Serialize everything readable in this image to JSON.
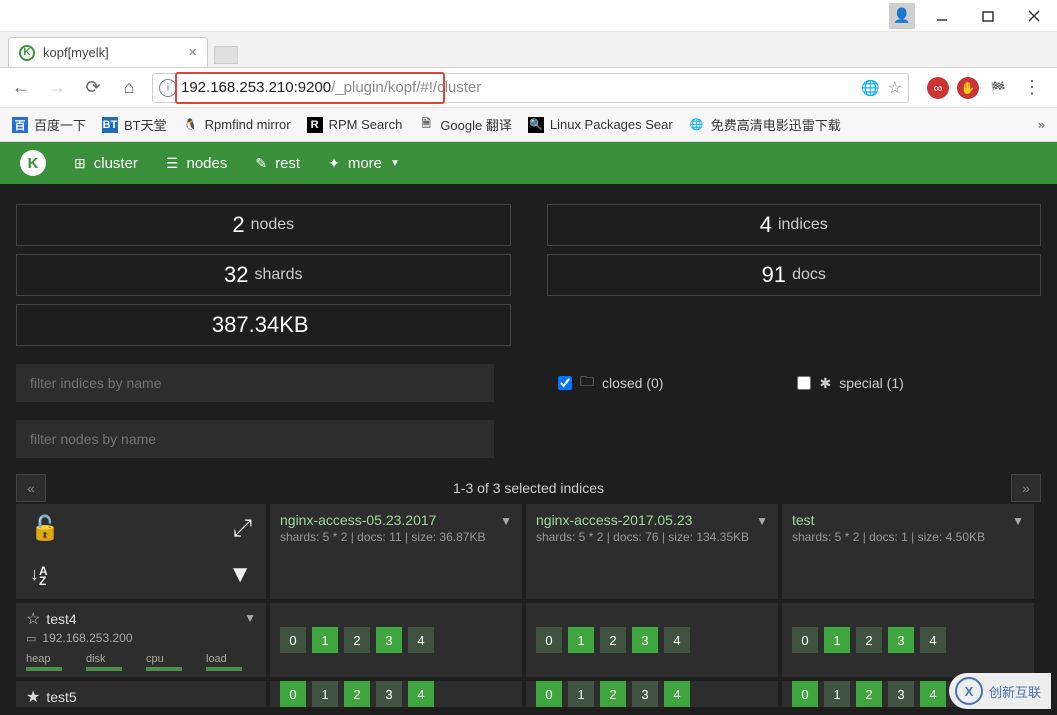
{
  "window": {
    "tab_title": "kopf[myelk]"
  },
  "url": {
    "host_port": "192.168.253.210:9200",
    "path": "/_plugin/kopf/",
    "hash": "#!/cluster"
  },
  "bookmarks": [
    {
      "icon": "百",
      "icon_bg": "#2b6cd4",
      "icon_color": "#fff",
      "label": "百度一下"
    },
    {
      "icon": "BT",
      "icon_bg": "#1d6fb8",
      "icon_color": "#fff",
      "label": "BT天堂"
    },
    {
      "icon": "🐧",
      "icon_bg": "transparent",
      "icon_color": "#000",
      "label": "Rpmfind mirror"
    },
    {
      "icon": "R",
      "icon_bg": "#000",
      "icon_color": "#fff",
      "label": "RPM Search"
    },
    {
      "icon": "🗎",
      "icon_bg": "transparent",
      "icon_color": "#666",
      "label": "Google 翻译"
    },
    {
      "icon": "🔍",
      "icon_bg": "#000",
      "icon_color": "#fff",
      "label": "Linux Packages Sear"
    },
    {
      "icon": "🌐",
      "icon_bg": "transparent",
      "icon_color": "#2b8",
      "label": "免费高清电影迅雷下载"
    }
  ],
  "nav": {
    "cluster": "cluster",
    "nodes": "nodes",
    "rest": "rest",
    "more": "more"
  },
  "stats": {
    "nodes_num": "2",
    "nodes_label": "nodes",
    "shards_num": "32",
    "shards_label": "shards",
    "size_value": "387.34KB",
    "indices_num": "4",
    "indices_label": "indices",
    "docs_num": "91",
    "docs_label": "docs"
  },
  "filters": {
    "indices_placeholder": "filter indices by name",
    "nodes_placeholder": "filter nodes by name",
    "closed_label": "closed (0)",
    "special_label": "special (1)"
  },
  "pager": {
    "text": "1-3 of 3 selected indices"
  },
  "indices": [
    {
      "name": "nginx-access-05.23.2017",
      "meta": "shards: 5 * 2 | docs: 11 | size: 36.87KB"
    },
    {
      "name": "nginx-access-2017.05.23",
      "meta": "shards: 5 * 2 | docs: 76 | size: 134.35KB"
    },
    {
      "name": "test",
      "meta": "shards: 5 * 2 | docs: 1 | size: 4.50KB"
    }
  ],
  "node": {
    "name": "test4",
    "ip": "192.168.253.200",
    "meters": [
      "heap",
      "disk",
      "cpu",
      "load"
    ]
  },
  "node2": {
    "name": "test5"
  },
  "shards": {
    "row1": [
      [
        {
          "n": "0",
          "s": "dim"
        },
        {
          "n": "1",
          "s": "bright"
        },
        {
          "n": "2",
          "s": "dim"
        },
        {
          "n": "3",
          "s": "bright"
        },
        {
          "n": "4",
          "s": "dim"
        }
      ],
      [
        {
          "n": "0",
          "s": "dim"
        },
        {
          "n": "1",
          "s": "bright"
        },
        {
          "n": "2",
          "s": "dim"
        },
        {
          "n": "3",
          "s": "bright"
        },
        {
          "n": "4",
          "s": "dim"
        }
      ],
      [
        {
          "n": "0",
          "s": "dim"
        },
        {
          "n": "1",
          "s": "bright"
        },
        {
          "n": "2",
          "s": "dim"
        },
        {
          "n": "3",
          "s": "bright"
        },
        {
          "n": "4",
          "s": "dim"
        }
      ]
    ]
  },
  "watermark": "创新互联"
}
